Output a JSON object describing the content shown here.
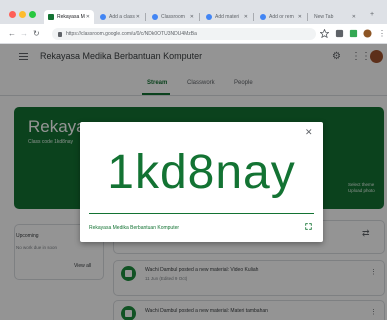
{
  "browser": {
    "tabs": [
      {
        "label": "Rekayasa M",
        "active": true
      },
      {
        "label": "Add a class",
        "active": false
      },
      {
        "label": "Classroom",
        "active": false
      },
      {
        "label": "Add materi",
        "active": false
      },
      {
        "label": "Add or rem",
        "active": false
      },
      {
        "label": "New Tab",
        "active": false
      }
    ],
    "url": "https://classroom.google.com/u/0/c/NDk0OTU3NDU4MzBa"
  },
  "header": {
    "course_name": "Rekayasa Medika Berbantuan Komputer",
    "tabs": [
      "Stream",
      "Classwork",
      "People"
    ]
  },
  "banner": {
    "title": "Rekayasa",
    "class_code_label": "Class code  1kd8nay",
    "side_text_1": "Select theme",
    "side_text_2": "Upload photo"
  },
  "upcoming": {
    "title": "Upcoming",
    "subtitle": "No work due in soon",
    "view_all": "View all"
  },
  "posts": [
    {
      "text": "Wachi Dambul posted a new material: Video Kuliah",
      "date": "11 Jun (Edited 9 Oct)"
    },
    {
      "text": "Wachi Dambul posted a new material: Materi tambahan",
      "date": ""
    }
  ],
  "modal": {
    "class_code": "1kd8nay",
    "course_name": "Rekayasa Medika Berbantuan Komputer"
  },
  "colors": {
    "brand_green": "#137333",
    "post_icon": "#1e8e3e"
  }
}
